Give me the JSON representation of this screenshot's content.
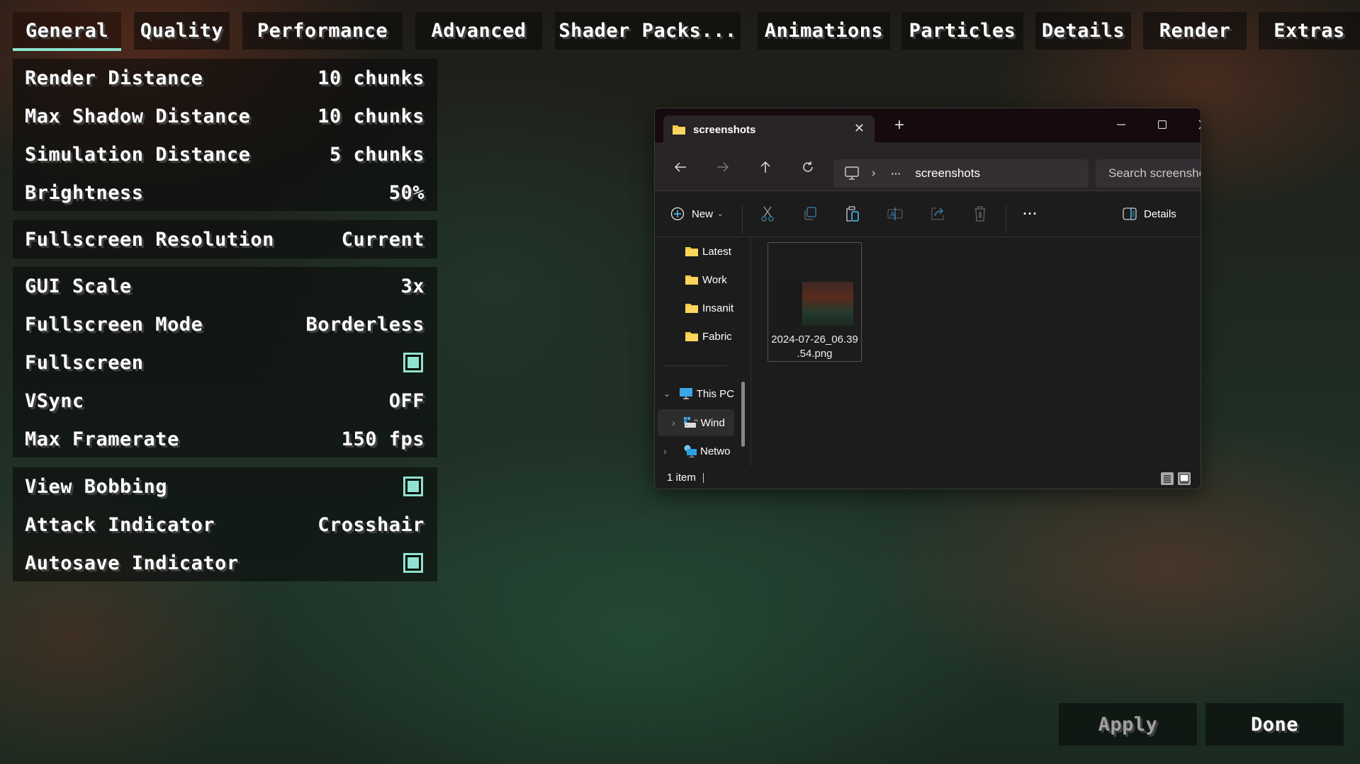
{
  "tabs": [
    {
      "label": "General",
      "active": true
    },
    {
      "label": "Quality",
      "active": false
    },
    {
      "label": "Performance",
      "active": false
    },
    {
      "label": "Advanced",
      "active": false
    },
    {
      "label": "Shader Packs...",
      "active": false
    },
    {
      "label": "Animations",
      "active": false
    },
    {
      "label": "Particles",
      "active": false
    },
    {
      "label": "Details",
      "active": false
    },
    {
      "label": "Render",
      "active": false
    },
    {
      "label": "Extras",
      "active": false
    }
  ],
  "accent_color": "#8ee3d0",
  "settings": {
    "group1": [
      {
        "label": "Render Distance",
        "value": "10 chunks"
      },
      {
        "label": "Max Shadow Distance",
        "value": "10 chunks"
      },
      {
        "label": "Simulation Distance",
        "value": "5 chunks"
      },
      {
        "label": "Brightness",
        "value": "50%"
      }
    ],
    "group2": [
      {
        "label": "Fullscreen Resolution",
        "value": "Current"
      }
    ],
    "group3": [
      {
        "label": "GUI Scale",
        "value": "3x"
      },
      {
        "label": "Fullscreen Mode",
        "value": "Borderless"
      },
      {
        "label": "Fullscreen",
        "checked": true
      },
      {
        "label": "VSync",
        "value": "OFF"
      },
      {
        "label": "Max Framerate",
        "value": "150 fps"
      }
    ],
    "group4": [
      {
        "label": "View Bobbing",
        "checked": true
      },
      {
        "label": "Attack Indicator",
        "value": "Crosshair"
      },
      {
        "label": "Autosave Indicator",
        "checked": true
      }
    ]
  },
  "buttons": {
    "apply": "Apply",
    "done": "Done"
  },
  "explorer": {
    "tab_title": "screenshots",
    "new_tab_icon": "plus-icon",
    "breadcrumb_more": "···",
    "breadcrumb_current": "screenshots",
    "search_placeholder": "Search screenshots",
    "new_label": "New",
    "details_label": "Details",
    "more_label": "···",
    "nav": {
      "quick": [
        "Latest",
        "Work",
        "Insanit",
        "Fabric"
      ],
      "this_pc": "This PC",
      "windows": "Wind",
      "network": "Netwo"
    },
    "file": {
      "name_line1": "2024-07-26_06.39",
      "name_line2": ".54.png"
    },
    "status": "1 item"
  }
}
